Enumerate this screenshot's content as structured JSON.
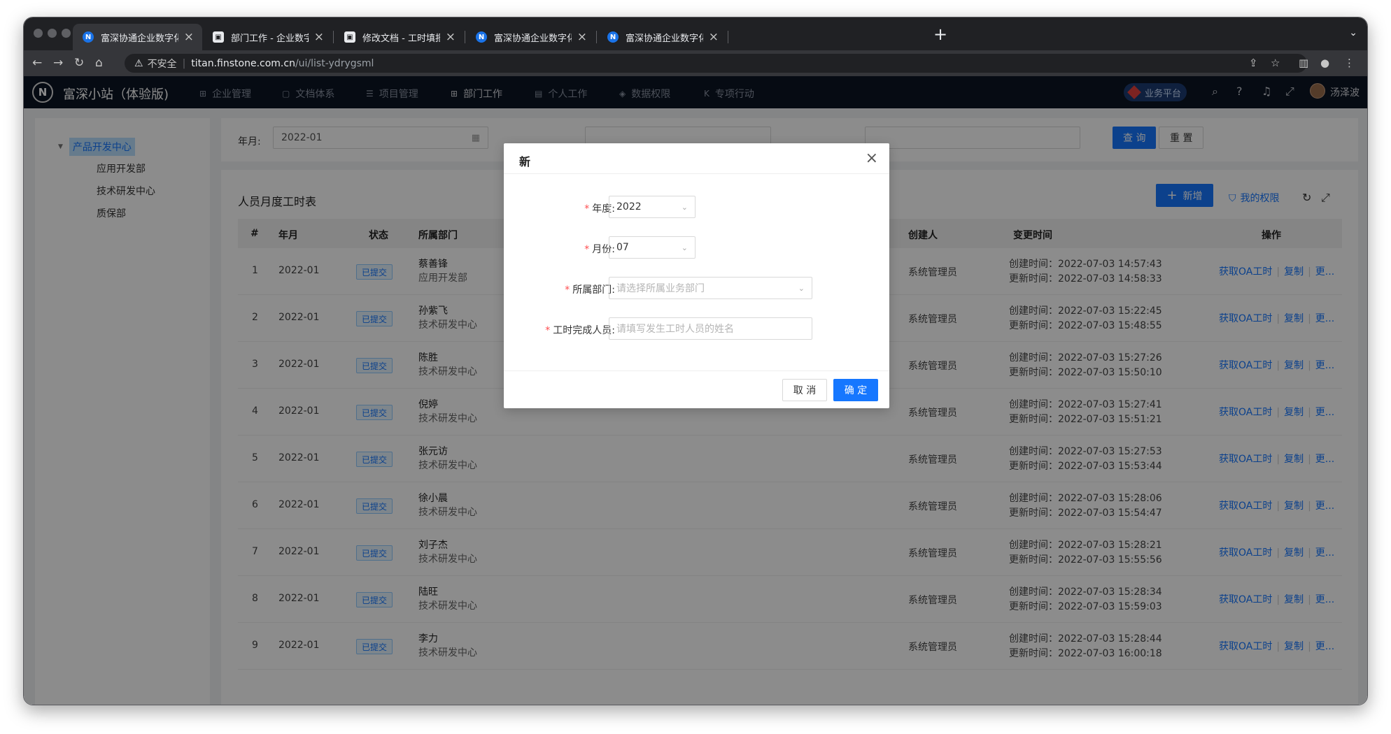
{
  "browser": {
    "tabs": [
      {
        "favicon": "N",
        "title": "富深协通企业数字化平台",
        "active": true
      },
      {
        "favicon": "▣",
        "title": "部门工作 - 企业数字化平台操作手",
        "active": false
      },
      {
        "favicon": "▣",
        "title": "修改文档 - 工时填报 - 在线文档",
        "active": false
      },
      {
        "favicon": "N",
        "title": "富深协通企业数字化平台",
        "active": false
      },
      {
        "favicon": "N",
        "title": "富深协通企业数字化平台",
        "active": false
      }
    ],
    "address": {
      "security_label": "不安全",
      "host": "titan.finstone.com.cn",
      "path": "/ui/list-ydrygsml"
    }
  },
  "app": {
    "logo": "N",
    "name": "富深小站（体验版)",
    "menu": [
      {
        "icon": "⊞",
        "label": "企业管理"
      },
      {
        "icon": "▢",
        "label": "文档体系"
      },
      {
        "icon": "☰",
        "label": "项目管理"
      },
      {
        "icon": "⊞",
        "label": "部门工作"
      },
      {
        "icon": "▤",
        "label": "个人工作"
      },
      {
        "icon": "◈",
        "label": "数据权限"
      },
      {
        "icon": "K",
        "label": "专项行动"
      }
    ],
    "business_button": "业务平台",
    "user_name": "汤泽波"
  },
  "sidebar": {
    "root": "产品开发中心",
    "children": [
      "应用开发部",
      "技术研发中心",
      "质保部"
    ]
  },
  "filter": {
    "month_label": "年月:",
    "month_value": "2022-01",
    "query_button": "查 询",
    "reset_button": "重 置"
  },
  "panel": {
    "title": "人员月度工时表",
    "add_button": "新增",
    "permission_link": "我的权限"
  },
  "table": {
    "headers": {
      "index": "#",
      "month": "年月",
      "status": "状态",
      "dept": "所属部门",
      "creator": "创建人",
      "time": "变更时间",
      "ops": "操作"
    },
    "create_prefix": "创建时间：",
    "update_prefix": "更新时间：",
    "ops_labels": {
      "oa": "获取OA工时",
      "copy": "复制",
      "more": "更..."
    },
    "rows": [
      {
        "index": "1",
        "month": "2022-01",
        "status": "已提交",
        "name": "蔡善锋",
        "dept": "应用开发部",
        "creator": "系统管理员",
        "created": "2022-07-03 14:57:43",
        "updated": "2022-07-03 14:58:33"
      },
      {
        "index": "2",
        "month": "2022-01",
        "status": "已提交",
        "name": "孙紫飞",
        "dept": "技术研发中心",
        "creator": "系统管理员",
        "created": "2022-07-03 15:22:45",
        "updated": "2022-07-03 15:48:55"
      },
      {
        "index": "3",
        "month": "2022-01",
        "status": "已提交",
        "name": "陈胜",
        "dept": "技术研发中心",
        "creator": "系统管理员",
        "created": "2022-07-03 15:27:26",
        "updated": "2022-07-03 15:50:10"
      },
      {
        "index": "4",
        "month": "2022-01",
        "status": "已提交",
        "name": "倪婷",
        "dept": "技术研发中心",
        "creator": "系统管理员",
        "created": "2022-07-03 15:27:41",
        "updated": "2022-07-03 15:51:21"
      },
      {
        "index": "5",
        "month": "2022-01",
        "status": "已提交",
        "name": "张元访",
        "dept": "技术研发中心",
        "creator": "系统管理员",
        "created": "2022-07-03 15:27:53",
        "updated": "2022-07-03 15:53:44"
      },
      {
        "index": "6",
        "month": "2022-01",
        "status": "已提交",
        "name": "徐小晨",
        "dept": "技术研发中心",
        "creator": "系统管理员",
        "created": "2022-07-03 15:28:06",
        "updated": "2022-07-03 15:54:47"
      },
      {
        "index": "7",
        "month": "2022-01",
        "status": "已提交",
        "name": "刘子杰",
        "dept": "技术研发中心",
        "creator": "系统管理员",
        "created": "2022-07-03 15:28:21",
        "updated": "2022-07-03 15:55:56"
      },
      {
        "index": "8",
        "month": "2022-01",
        "status": "已提交",
        "name": "陆旺",
        "dept": "技术研发中心",
        "creator": "系统管理员",
        "created": "2022-07-03 15:28:34",
        "updated": "2022-07-03 15:59:03"
      },
      {
        "index": "9",
        "month": "2022-01",
        "status": "已提交",
        "name": "李力",
        "dept": "技术研发中心",
        "creator": "系统管理员",
        "created": "2022-07-03 15:28:44",
        "updated": "2022-07-03 16:00:18"
      }
    ]
  },
  "modal": {
    "title": "新",
    "fields": {
      "year": {
        "label": "年度:",
        "value": "2022"
      },
      "month": {
        "label": "月份:",
        "value": "07"
      },
      "dept": {
        "label": "所属部门:",
        "placeholder": "请选择所属业务部门"
      },
      "person": {
        "label": "工时完成人员:",
        "placeholder": "请填写发生工时人员的姓名"
      }
    },
    "cancel": "取 消",
    "ok": "确 定"
  }
}
